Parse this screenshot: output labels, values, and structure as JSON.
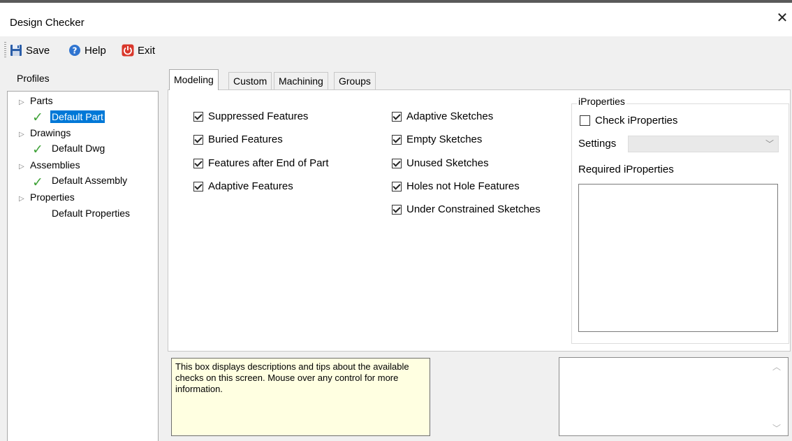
{
  "window": {
    "title": "Design Checker",
    "close_glyph": "✕"
  },
  "toolbar": {
    "save_label": "Save",
    "save_icon": "save-disk-icon",
    "help_label": "Help",
    "help_icon": "help-question-icon",
    "exit_label": "Exit",
    "exit_icon": "power-exit-icon"
  },
  "profiles": {
    "label": "Profiles",
    "tree": [
      {
        "label": "Parts",
        "children": [
          "Default Part"
        ],
        "selected": "Default Part",
        "checked": true
      },
      {
        "label": "Drawings",
        "children": [
          "Default Dwg"
        ],
        "checked": true
      },
      {
        "label": "Assemblies",
        "children": [
          "Default Assembly"
        ],
        "checked": true
      },
      {
        "label": "Properties",
        "children": [
          "Default Properties"
        ],
        "checked": false
      }
    ]
  },
  "tabs": [
    "Modeling",
    "Custom",
    "Machining",
    "Groups"
  ],
  "active_tab": "Modeling",
  "modeling": {
    "left": [
      {
        "label": "Suppressed Features",
        "checked": true
      },
      {
        "label": "Buried Features",
        "checked": true
      },
      {
        "label": "Features after End of Part",
        "checked": true
      },
      {
        "label": "Adaptive Features",
        "checked": true
      }
    ],
    "right": [
      {
        "label": "Adaptive Sketches",
        "checked": true
      },
      {
        "label": "Empty Sketches",
        "checked": true
      },
      {
        "label": "Unused Sketches",
        "checked": true
      },
      {
        "label": "Holes not Hole Features",
        "checked": true
      },
      {
        "label": "Under Constrained Sketches",
        "checked": true
      }
    ]
  },
  "iproperties": {
    "group_label": "iProperties",
    "check_label": "Check iProperties",
    "check_checked": false,
    "settings_label": "Settings",
    "settings_value": "",
    "required_label": "Required iProperties"
  },
  "tips": {
    "text": "This box displays descriptions and tips about the available checks on this screen. Mouse over any control for more information."
  },
  "colors": {
    "accent": "#0078d7",
    "check_green": "#3fa238",
    "tips_bg": "#ffffe1"
  }
}
